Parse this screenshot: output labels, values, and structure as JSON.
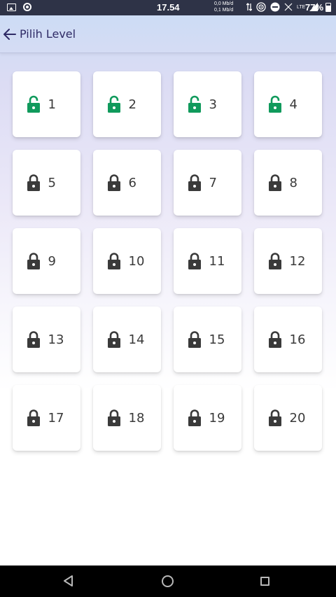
{
  "status_bar": {
    "time": "17.54",
    "net_up": "0,0 Mb/d",
    "net_down": "0,1 Mb/d",
    "network": "LTE",
    "battery": "77%"
  },
  "header": {
    "title": "Pilih Level",
    "back_icon": "arrow-left-icon"
  },
  "colors": {
    "unlocked": "#109a5c",
    "locked": "#3a3a3a",
    "title": "#2f2b66"
  },
  "levels": [
    {
      "number": "1",
      "unlocked": true
    },
    {
      "number": "2",
      "unlocked": true
    },
    {
      "number": "3",
      "unlocked": true
    },
    {
      "number": "4",
      "unlocked": true
    },
    {
      "number": "5",
      "unlocked": false
    },
    {
      "number": "6",
      "unlocked": false
    },
    {
      "number": "7",
      "unlocked": false
    },
    {
      "number": "8",
      "unlocked": false
    },
    {
      "number": "9",
      "unlocked": false
    },
    {
      "number": "10",
      "unlocked": false
    },
    {
      "number": "11",
      "unlocked": false
    },
    {
      "number": "12",
      "unlocked": false
    },
    {
      "number": "13",
      "unlocked": false
    },
    {
      "number": "14",
      "unlocked": false
    },
    {
      "number": "15",
      "unlocked": false
    },
    {
      "number": "16",
      "unlocked": false
    },
    {
      "number": "17",
      "unlocked": false
    },
    {
      "number": "18",
      "unlocked": false
    },
    {
      "number": "19",
      "unlocked": false
    },
    {
      "number": "20",
      "unlocked": false
    }
  ]
}
